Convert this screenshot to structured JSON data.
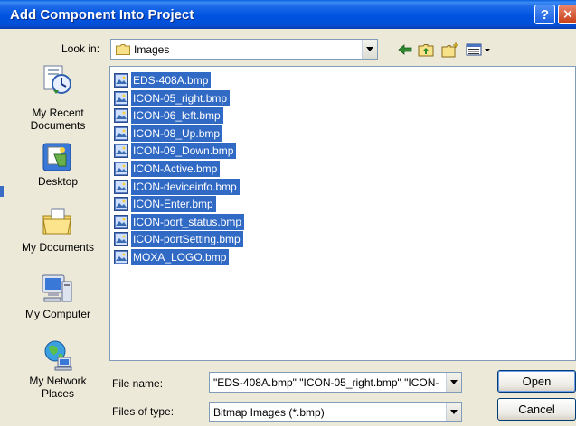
{
  "window": {
    "title": "Add Component Into Project",
    "help_glyph": "?",
    "close_glyph": "✕"
  },
  "look_in": {
    "label": "Look in:",
    "value": "Images"
  },
  "places": [
    {
      "label": "My Recent\nDocuments",
      "icon": "recent-documents-icon"
    },
    {
      "label": "Desktop",
      "icon": "desktop-icon"
    },
    {
      "label": "My Documents",
      "icon": "my-documents-icon"
    },
    {
      "label": "My Computer",
      "icon": "my-computer-icon"
    },
    {
      "label": "My Network\nPlaces",
      "icon": "network-places-icon"
    }
  ],
  "files": [
    "EDS-408A.bmp",
    "ICON-05_right.bmp",
    "ICON-06_left.bmp",
    "ICON-08_Up.bmp",
    "ICON-09_Down.bmp",
    "ICON-Active.bmp",
    "ICON-deviceinfo.bmp",
    "ICON-Enter.bmp",
    "ICON-port_status.bmp",
    "ICON-portSetting.bmp",
    "MOXA_LOGO.bmp"
  ],
  "file_name": {
    "label": "File name:",
    "value": "\"EDS-408A.bmp\" \"ICON-05_right.bmp\" \"ICON-"
  },
  "files_of_type": {
    "label": "Files of type:",
    "value": "Bitmap Images (*.bmp)"
  },
  "buttons": {
    "open": "Open",
    "cancel": "Cancel"
  },
  "colors": {
    "selection": "#316ac5",
    "titlebar": "#0053e0",
    "dialog_bg": "#ece9d8"
  }
}
